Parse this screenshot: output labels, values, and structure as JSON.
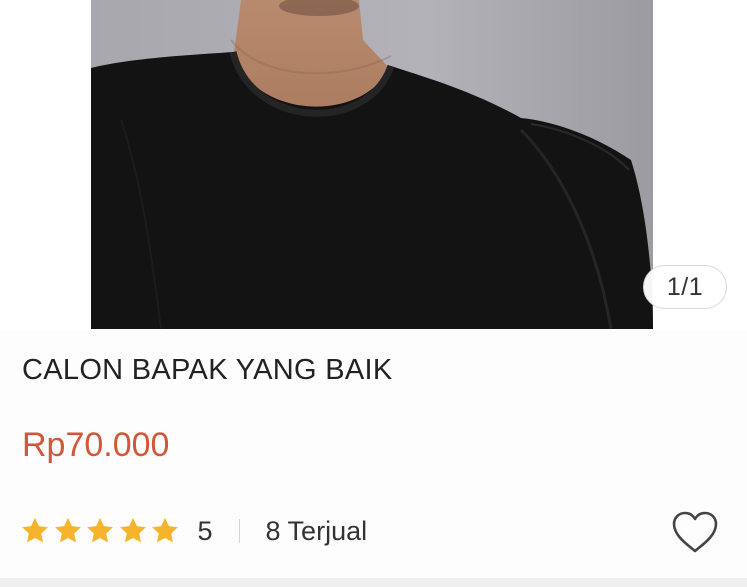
{
  "gallery": {
    "image_alt": "Man wearing black t-shirt",
    "counter": "1/1"
  },
  "product": {
    "title": "CALON BAPAK YANG BAIK",
    "price": "Rp70.000",
    "rating_stars": 5,
    "rating_value": "5",
    "sold": "8 Terjual"
  },
  "colors": {
    "price": "#d0573a",
    "star": "#f6b42c",
    "text": "#222222",
    "shirt": "#131313"
  },
  "icons": {
    "star": "star-icon",
    "wishlist": "heart-outline-icon"
  }
}
